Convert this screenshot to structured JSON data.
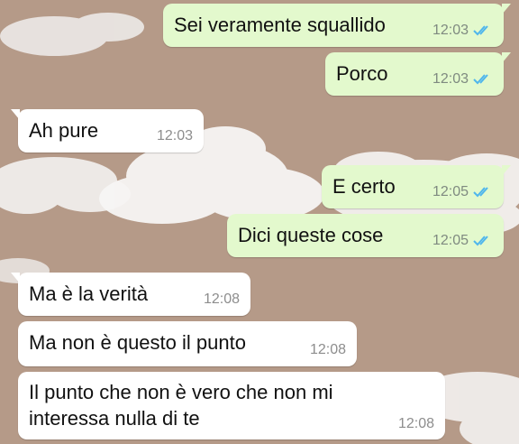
{
  "colors": {
    "background": "#b59a88",
    "outgoing_bubble": "#e3f9cd",
    "incoming_bubble": "#ffffff",
    "read_ticks": "#4fb6ec",
    "timestamp": "#8d8d8d"
  },
  "messages": [
    {
      "direction": "outgoing",
      "text": "Sei veramente squallido",
      "time": "12:03",
      "status_icon": "double-check-read-icon"
    },
    {
      "direction": "outgoing",
      "text": "Porco",
      "time": "12:03",
      "status_icon": "double-check-read-icon"
    },
    {
      "direction": "incoming",
      "text": "Ah pure",
      "time": "12:03"
    },
    {
      "direction": "outgoing",
      "text": "E certo",
      "time": "12:05",
      "status_icon": "double-check-read-icon"
    },
    {
      "direction": "outgoing",
      "text": "Dici queste cose",
      "time": "12:05",
      "status_icon": "double-check-read-icon"
    },
    {
      "direction": "incoming",
      "text": "Ma è la verità",
      "time": "12:08"
    },
    {
      "direction": "incoming",
      "text": "Ma non è questo il punto",
      "time": "12:08"
    },
    {
      "direction": "incoming",
      "text": "Il punto che non è vero che non mi interessa nulla di te",
      "time": "12:08"
    }
  ]
}
